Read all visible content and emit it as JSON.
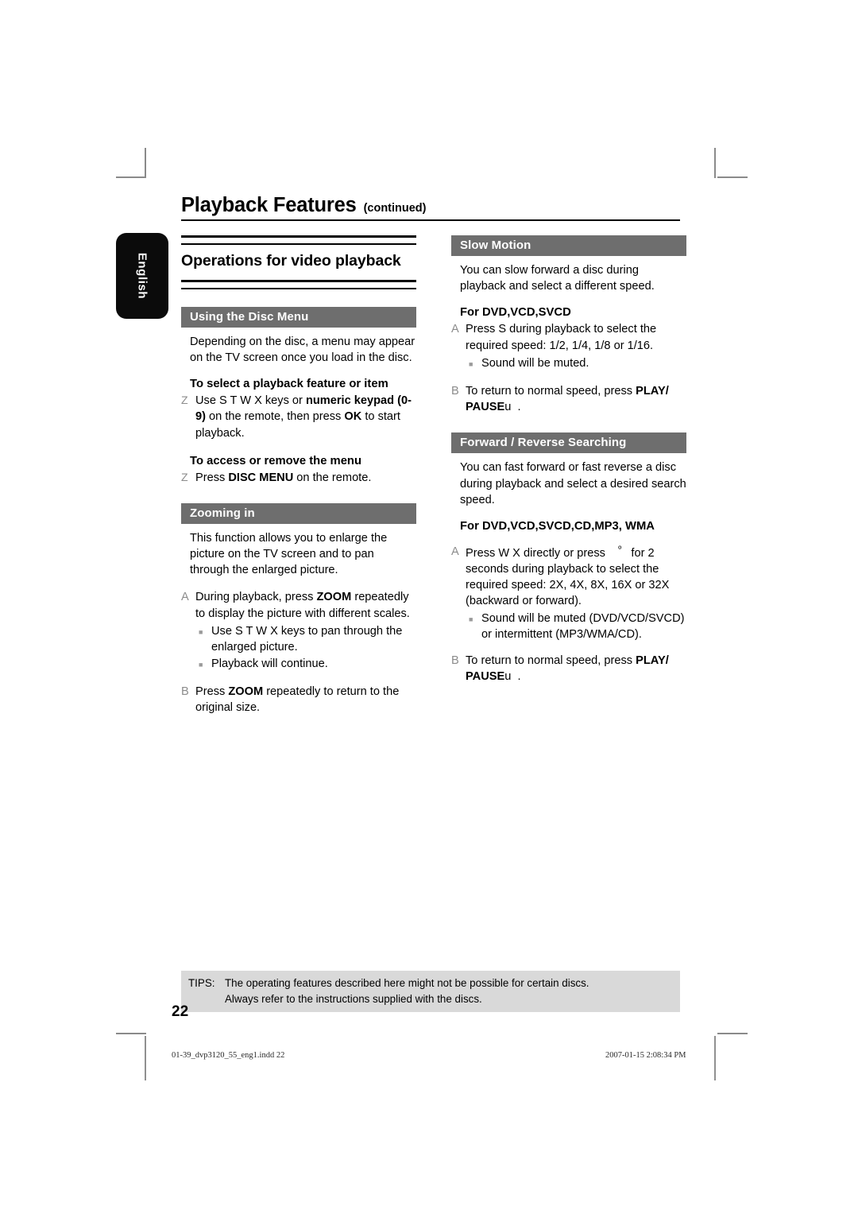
{
  "header": {
    "title": "Playback Features",
    "continued": "(continued)"
  },
  "language_tab": {
    "label": "English"
  },
  "left_column": {
    "major_title": "Operations for video playback",
    "sections": [
      {
        "bar_label": "Using the Disc Menu",
        "intro": "Depending on the disc, a menu may appear on the TV screen once you load in the disc.",
        "sub_a_head": "To select a playback feature or item",
        "sub_a_marker": "Z",
        "sub_a_text_1": "Use  S  T   W X keys or ",
        "sub_a_bold_1": "numeric keypad (0-9)",
        "sub_a_text_2": " on the remote, then press ",
        "sub_a_bold_2": "OK",
        "sub_a_text_3": " to start playback.",
        "sub_b_head": "To access or remove the menu",
        "sub_b_marker": "Z",
        "sub_b_text_1": "Press ",
        "sub_b_bold_1": "DISC MENU",
        "sub_b_text_2": " on the remote."
      },
      {
        "bar_label": "Zooming in",
        "intro": "This function allows you to enlarge the picture on the TV screen and to pan through the enlarged picture.",
        "item_a_marker": "A",
        "item_a_text_1": "During playback, press ",
        "item_a_bold_1": "ZOOM",
        "item_a_text_2": " repeatedly to display the picture with different scales.",
        "bullets": [
          "Use  S  T  W X keys to pan through the enlarged picture.",
          "Playback will continue."
        ],
        "item_b_marker": "B",
        "item_b_text_1": "Press ",
        "item_b_bold_1": "ZOOM",
        "item_b_text_2": " repeatedly to return to the original size."
      }
    ]
  },
  "right_column": {
    "sections": [
      {
        "bar_label": "Slow Motion",
        "intro": "You can slow forward a disc during playback and select a different speed.",
        "sub_head": "For DVD,VCD,SVCD",
        "item_a_marker": "A",
        "item_a_text": "Press  S during playback to select the required speed: 1/2, 1/4, 1/8 or 1/16.",
        "bullets": [
          "Sound will be muted."
        ],
        "item_b_marker": "B",
        "item_b_text_1": "To return to normal speed, press ",
        "item_b_bold_1": "PLAY/ PAUSE",
        "item_b_glyph": "u",
        "item_b_text_2": "."
      },
      {
        "bar_label": "Forward / Reverse Searching",
        "intro": "You can fast forward or fast reverse a disc during playback and select a desired search speed.",
        "sub_head": "For DVD,VCD,SVCD,CD,MP3, WMA",
        "item_a_marker": "A",
        "item_a_text_1": "Press  W X directly or press ",
        "item_a_glyph": "º",
        "item_a_text_2": " for 2 seconds during playback to select the required speed: 2X, 4X, 8X, 16X or 32X (backward or forward).",
        "bullets": [
          "Sound will be muted (DVD/VCD/SVCD) or intermittent (MP3/WMA/CD)."
        ],
        "item_b_marker": "B",
        "item_b_text_1": "To return to normal speed, press ",
        "item_b_bold_1": "PLAY/ PAUSE",
        "item_b_glyph": "u",
        "item_b_text_2": "."
      }
    ]
  },
  "tips": {
    "label": "TIPS:",
    "line1": "The operating features described here might not be possible for certain discs.",
    "line2": "Always refer to the instructions supplied with the discs."
  },
  "page_number": "22",
  "imposition_footer": {
    "file": "01-39_dvp3120_55_eng1.indd   22",
    "timestamp": "2007-01-15   2:08:34 PM"
  },
  "colors": {
    "section_bar": "#6e6e6e",
    "tips_background": "#d9d9d9",
    "marker_gray": "#8c8c8c",
    "tab_background": "#0b0b0b"
  }
}
